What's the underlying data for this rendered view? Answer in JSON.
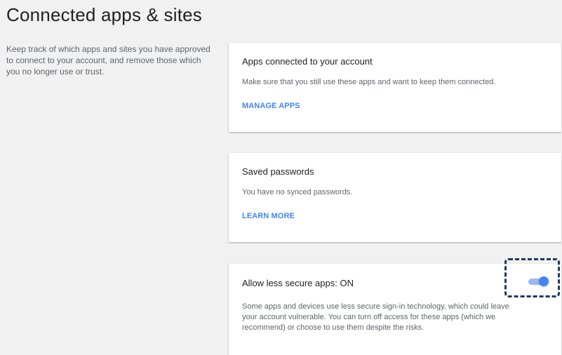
{
  "page": {
    "title": "Connected apps & sites",
    "intro": "Keep track of which apps and sites you have approved to connect to your account, and remove those which you no longer use or trust."
  },
  "cards": {
    "apps": {
      "title": "Apps connected to your account",
      "description": "Make sure that you still use these apps and want to keep them connected.",
      "link_label": "MANAGE APPS"
    },
    "passwords": {
      "title": "Saved passwords",
      "description": "You have no synced passwords.",
      "link_label": "LEARN MORE"
    },
    "less_secure": {
      "title": "Allow less secure apps: ON",
      "description": "Some apps and devices use less secure sign-in technology, which could leave your account vulnerable. You can turn off access for these apps (which we recommend) or choose to use them despite the risks.",
      "toggle_state": "on"
    }
  },
  "colors": {
    "accent": "#4285f4",
    "toggle_track": "#9ab6f2",
    "highlight": "#1e3a5f"
  }
}
